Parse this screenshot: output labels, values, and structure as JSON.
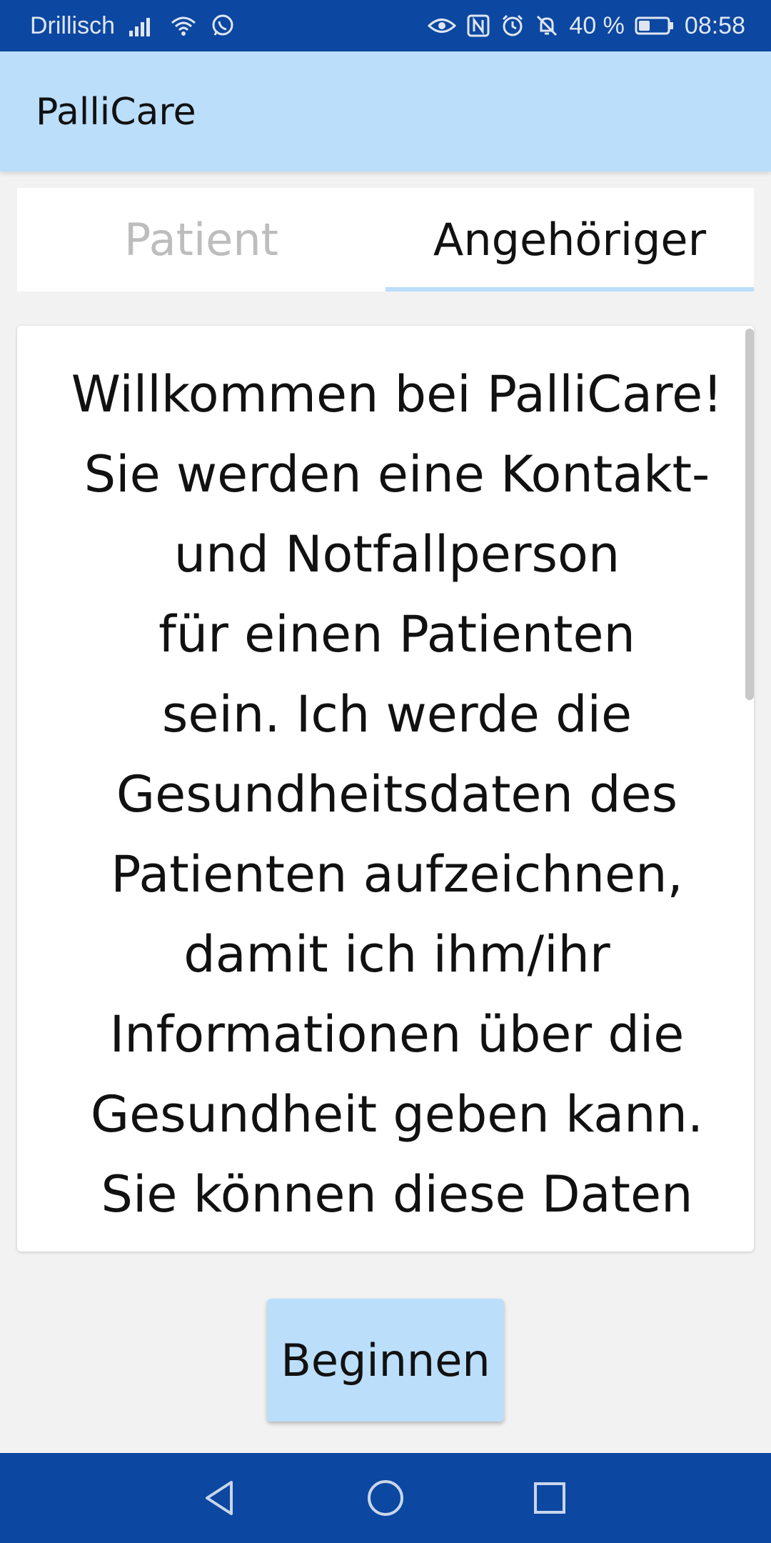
{
  "status_bar": {
    "carrier": "Drillisch",
    "battery_percent": "40 %",
    "time": "08:58",
    "icons_left": [
      "signal-icon",
      "wifi-icon",
      "whatsapp-icon"
    ],
    "icons_right": [
      "eye-icon",
      "nfc-icon",
      "alarm-icon",
      "mute-icon",
      "battery-icon"
    ],
    "battery_level": 0.4
  },
  "app_bar": {
    "title": "PalliCare"
  },
  "tabs": [
    {
      "label": "Patient",
      "selected": false
    },
    {
      "label": "Angehöriger",
      "selected": true
    }
  ],
  "content": {
    "lines": [
      "Willkommen bei PalliCare!",
      "Sie werden eine Kontakt-",
      "und Notfallperson",
      "für einen Patienten",
      "sein. Ich werde die",
      "Gesundheitsdaten des",
      "Patienten aufzeichnen,",
      "damit ich ihm/ihr",
      "Informationen über die",
      "Gesundheit geben kann.",
      "Sie können diese Daten"
    ]
  },
  "button": {
    "label": "Beginnen"
  },
  "nav_bar": {
    "icons": [
      "back-icon",
      "home-icon",
      "recents-icon"
    ]
  },
  "colors": {
    "status_bar": "#0c47a1",
    "app_bar": "#bbdefb",
    "background": "#f2f2f2",
    "tab_inactive_text": "#bdbdbd",
    "tab_indicator": "#bbdefb"
  }
}
